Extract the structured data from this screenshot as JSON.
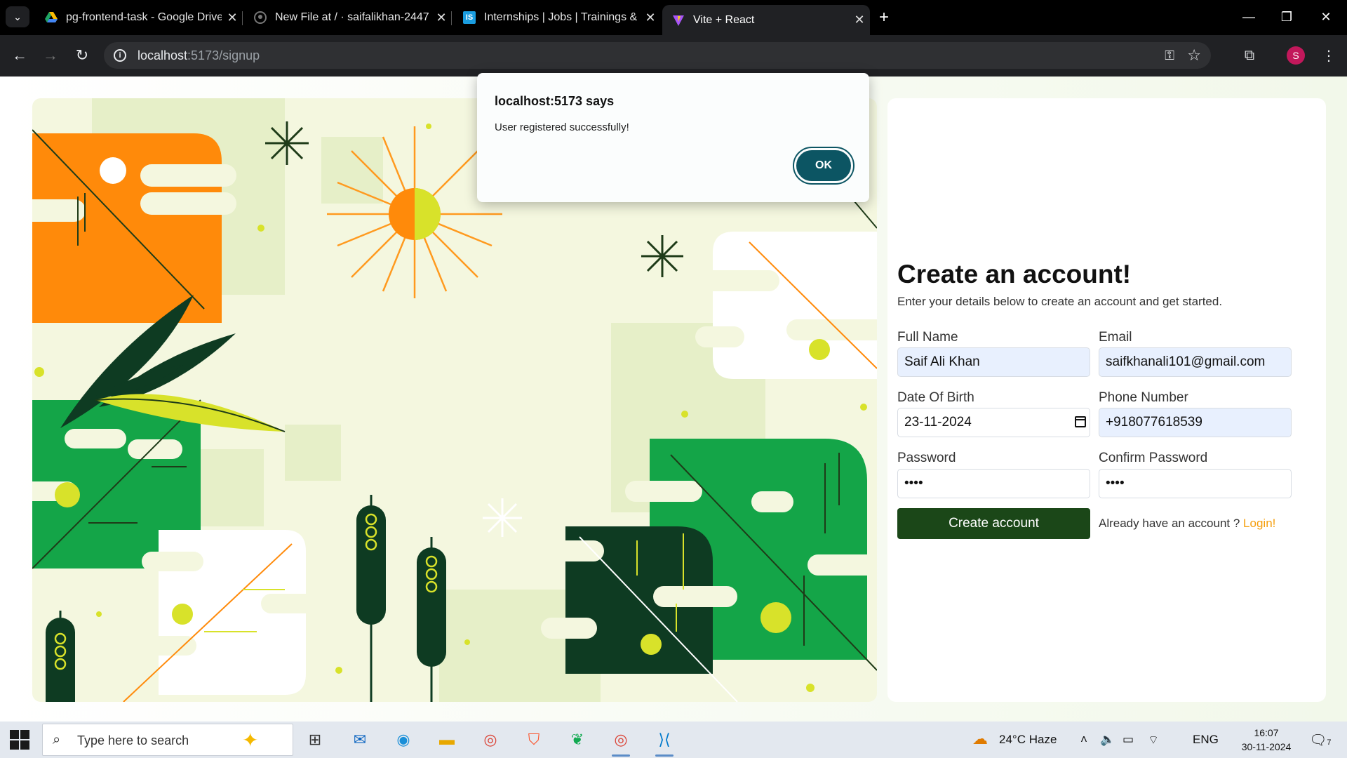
{
  "browser": {
    "tabs": [
      {
        "title": "pg-frontend-task - Google Drive",
        "favicon": "google-drive-icon"
      },
      {
        "title": "New File at / · saifalikhan-2447",
        "favicon": "github-icon"
      },
      {
        "title": "Internships | Jobs | Trainings & Fresher Jobs",
        "favicon": "internshala-icon"
      },
      {
        "title": "Vite + React",
        "favicon": "vite-icon",
        "active": true
      }
    ],
    "url_host": "localhost",
    "url_path": ":5173/signup",
    "profile_initial": "S"
  },
  "dialog": {
    "title": "localhost:5173 says",
    "message": "User registered successfully!",
    "ok_label": "OK"
  },
  "form": {
    "title": "Create an account!",
    "subtitle": "Enter your details below to create an account and get started.",
    "full_name": {
      "label": "Full Name",
      "value": "Saif Ali Khan"
    },
    "email": {
      "label": "Email",
      "value": "saifkhanali101@gmail.com"
    },
    "dob": {
      "label": "Date Of Birth",
      "value": "23-11-2024"
    },
    "phone": {
      "label": "Phone Number",
      "value": "+918077618539"
    },
    "password": {
      "label": "Password",
      "value": "••••"
    },
    "confirm_password": {
      "label": "Confirm Password",
      "value": "••••"
    },
    "submit_label": "Create account",
    "login_prompt": "Already have an account ?",
    "login_link": "Login!"
  },
  "taskbar": {
    "search_placeholder": "Type here to search",
    "weather": "24°C  Haze",
    "language": "ENG",
    "time": "16:07",
    "date": "30-11-2024",
    "notification_count": "7"
  },
  "colors": {
    "brand_green": "#1b4718",
    "accent_orange": "#f59e0b",
    "dialog_button": "#0c5563"
  }
}
